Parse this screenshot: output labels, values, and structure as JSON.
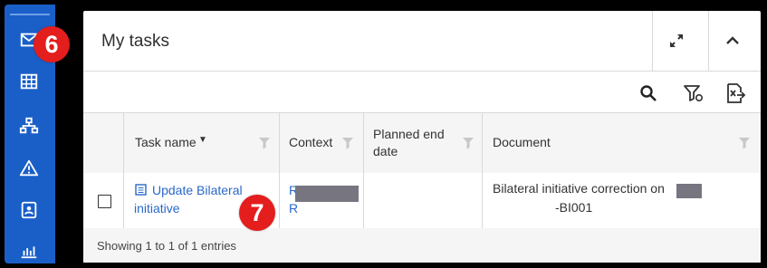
{
  "panel": {
    "title": "My tasks"
  },
  "sidebar": {
    "items": [
      {
        "icon": "mail-icon"
      },
      {
        "icon": "grid-icon"
      },
      {
        "icon": "org-chart-icon"
      },
      {
        "icon": "warning-icon"
      },
      {
        "icon": "contact-card-icon"
      },
      {
        "icon": "bar-chart-icon"
      }
    ]
  },
  "table": {
    "columns": {
      "task_name": "Task name",
      "context": "Context",
      "planned_end": "Planned end date",
      "document": "Document"
    },
    "rows": [
      {
        "task_name": "Update Bilateral initiative",
        "context_line1": "R",
        "context_line2": "R",
        "planned_end": "",
        "document_line1": "Bilateral initiative correction on",
        "document_line2": "-BI001"
      }
    ],
    "footer": "Showing 1 to 1 of 1 entries"
  },
  "annotations": {
    "step1": "6",
    "step2": "7"
  },
  "colors": {
    "sidebar": "#1a5fc8",
    "link": "#2a68c9",
    "badge": "#e41d1d"
  }
}
